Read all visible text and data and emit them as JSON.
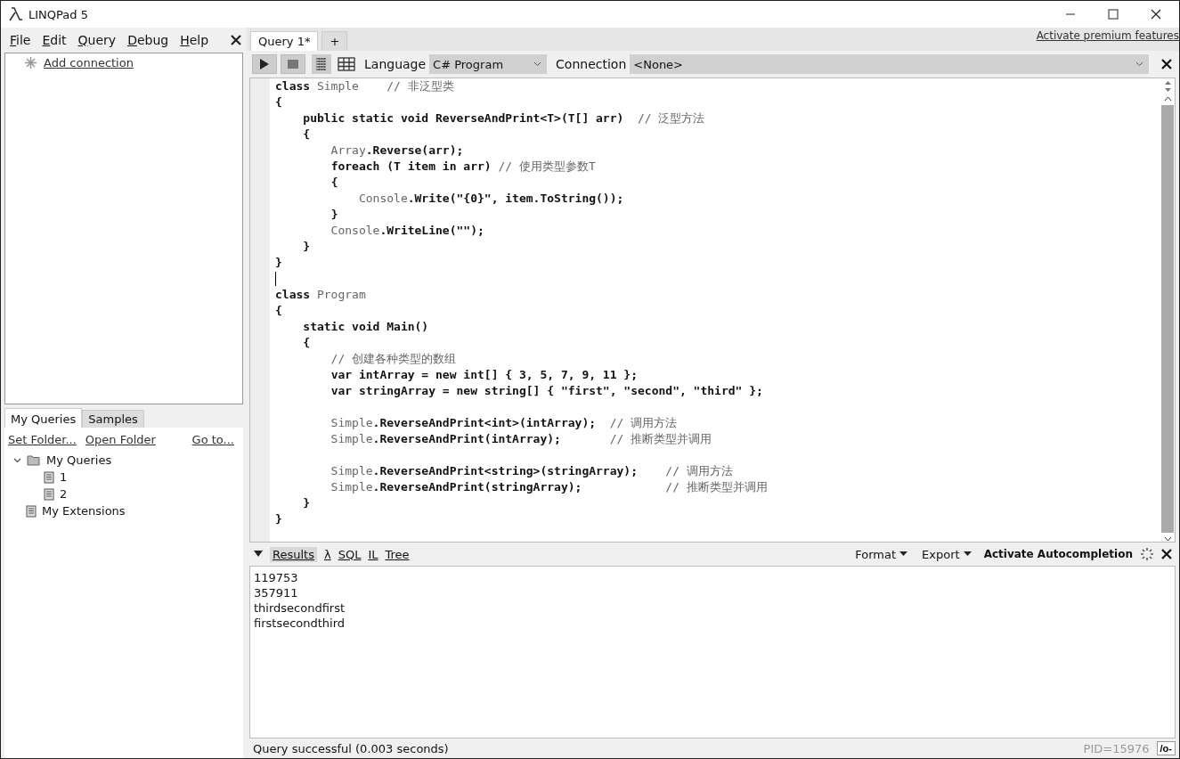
{
  "window": {
    "title": "LINQPad 5"
  },
  "menu": [
    "File",
    "Edit",
    "Query",
    "Debug",
    "Help"
  ],
  "connections": {
    "add_link": "Add connection"
  },
  "side_tabs": [
    {
      "label": "My Queries",
      "selected": true
    },
    {
      "label": "Samples",
      "selected": false
    }
  ],
  "folder_links": [
    "Set Folder...",
    "Open Folder",
    "Go to..."
  ],
  "tree": [
    {
      "label": "My Queries",
      "kind": "folder",
      "expanded": true,
      "children": [
        {
          "label": "1",
          "kind": "file"
        },
        {
          "label": "2",
          "kind": "file"
        }
      ]
    },
    {
      "label": "My Extensions",
      "kind": "file"
    }
  ],
  "query_tabs": [
    {
      "label": "Query 1*",
      "selected": true
    },
    {
      "label": "+",
      "selected": false
    }
  ],
  "premium_link": "Activate premium features",
  "toolbar": {
    "language_label": "Language",
    "language": "C# Program",
    "connection_label": "Connection",
    "connection": "<None>"
  },
  "code": [
    {
      "text": "**class** Simple    // 非泛型类"
    },
    {
      "text": "**{**"
    },
    {
      "text": "    **public static void ReverseAndPrint<T>(T[] arr)**  // 泛型方法"
    },
    {
      "text": "    **{**"
    },
    {
      "text": "        Array**.Reverse(arr);**"
    },
    {
      "text": "        **foreach (T item in arr)** // 使用类型参数T"
    },
    {
      "text": "        **{**"
    },
    {
      "text": "            Console**.Write(\"{0}\", item.ToString());**"
    },
    {
      "text": "        **}**"
    },
    {
      "text": "        Console**.WriteLine(\"\");**"
    },
    {
      "text": "    **}**"
    },
    {
      "text": "**}**"
    },
    {
      "text": "**class** Program",
      "blank_line_before": true,
      "caret_in_blank": true
    },
    {
      "text": "**{**"
    },
    {
      "text": "    **static void Main()**"
    },
    {
      "text": "    **{**"
    },
    {
      "text": "        // 创建各种类型的数组"
    },
    {
      "text": "        **var intArray = new int[] { 3, 5, 7, 9, 11 };**"
    },
    {
      "text": "        **var stringArray = new string[] { \"first\", \"second\", \"third\" };**"
    },
    {
      "text": "        Simple**.ReverseAndPrint<int>(intArray);**  // 调用方法",
      "blank_line_before": true
    },
    {
      "text": "        Simple**.ReverseAndPrint(intArray);**       // 推断类型并调用"
    },
    {
      "text": "        Simple**.ReverseAndPrint<string>(stringArray);**    // 调用方法",
      "blank_line_before": true
    },
    {
      "text": "        Simple**.ReverseAndPrint(stringArray);**            // 推断类型并调用"
    },
    {
      "text": "    **}**"
    },
    {
      "text": "**}**"
    }
  ],
  "result_tabs": [
    {
      "label": "Results",
      "selected": true
    },
    {
      "label": "λ",
      "selected": false
    },
    {
      "label": "SQL",
      "selected": false
    },
    {
      "label": "IL",
      "selected": false
    },
    {
      "label": "Tree",
      "selected": false
    }
  ],
  "result_menus": [
    "Format",
    "Export"
  ],
  "autocompletion": "Activate Autocompletion",
  "output": [
    "119753",
    "357911",
    "thirdsecondfirst",
    "firstsecondthird"
  ],
  "status_bar": {
    "message": "Query successful  (0.003 seconds)",
    "pid": "PID=15976",
    "button": "/o-"
  }
}
